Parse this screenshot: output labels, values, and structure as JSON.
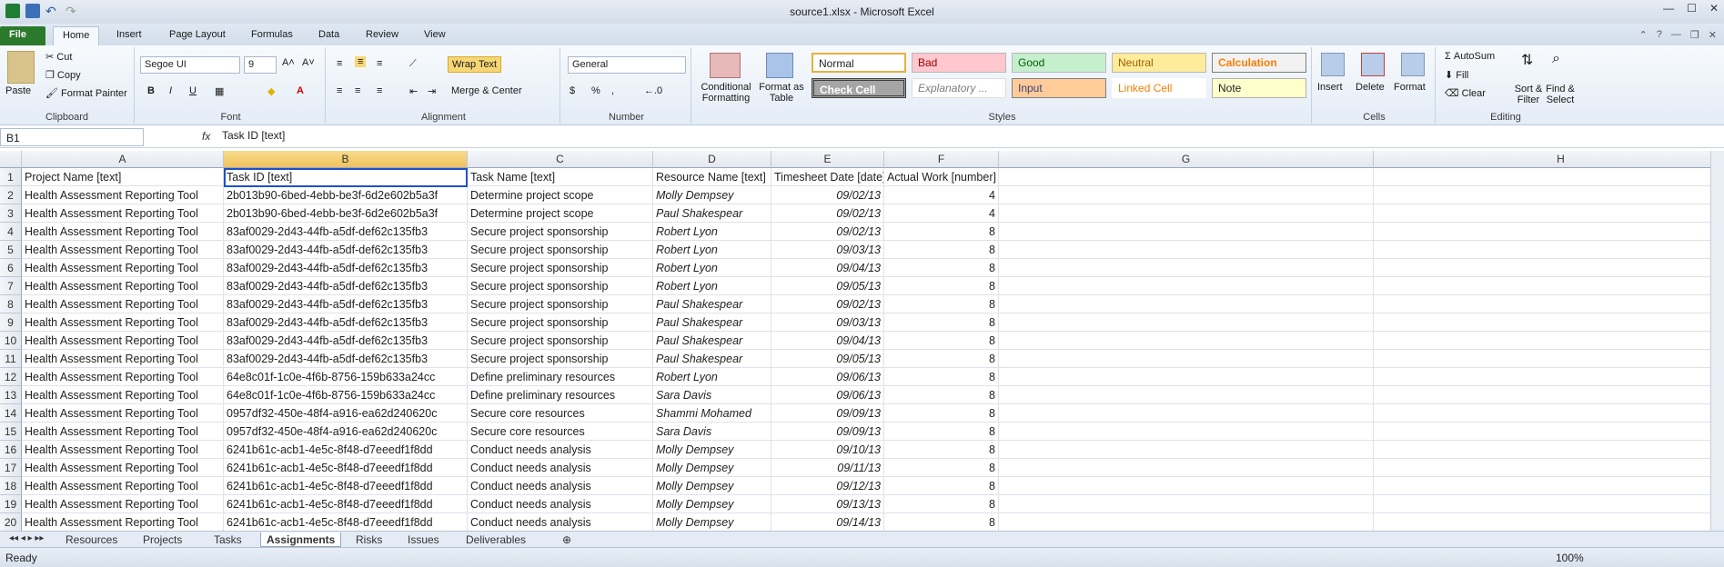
{
  "window": {
    "title": "source1.xlsx - Microsoft Excel"
  },
  "tabs": [
    "File",
    "Home",
    "Insert",
    "Page Layout",
    "Formulas",
    "Data",
    "Review",
    "View"
  ],
  "ribbon": {
    "clipboard": {
      "paste": "Paste",
      "cut": "Cut",
      "copy": "Copy",
      "format_painter": "Format Painter",
      "label": "Clipboard"
    },
    "font": {
      "name": "Segoe UI",
      "size": "9",
      "bold": "B",
      "italic": "I",
      "underline": "U",
      "label": "Font"
    },
    "alignment": {
      "wrap": "Wrap Text",
      "merge": "Merge & Center",
      "label": "Alignment"
    },
    "number": {
      "format": "General",
      "percent": "%",
      "comma": ",",
      "label": "Number"
    },
    "styles": {
      "conditional": "Conditional Formatting",
      "format_table": "Format as Table",
      "label": "Styles",
      "cells": [
        "Normal",
        "Bad",
        "Good",
        "Neutral",
        "Calculation",
        "Check Cell",
        "Explanatory ...",
        "Input",
        "Linked Cell",
        "Note"
      ]
    },
    "cells": {
      "insert": "Insert",
      "delete": "Delete",
      "format": "Format",
      "label": "Cells"
    },
    "editing": {
      "autosum": "AutoSum",
      "fill": "Fill",
      "clear": "Clear",
      "sort": "Sort & Filter",
      "find": "Find & Select",
      "label": "Editing"
    }
  },
  "formula_bar": {
    "name_box": "B1",
    "fx": "fx",
    "content": "Task ID [text]"
  },
  "columns": [
    "A",
    "B",
    "C",
    "D",
    "E",
    "F",
    "G",
    "H"
  ],
  "rows": [
    [
      "Project Name [text]",
      "Task ID [text]",
      "Task Name [text]",
      "Resource Name [text]",
      "Timesheet Date [date]",
      "Actual Work [number]"
    ],
    [
      "Health Assessment Reporting Tool",
      "2b013b90-6bed-4ebb-be3f-6d2e602b5a3f",
      "Determine project scope",
      "Molly Dempsey",
      "09/02/13",
      "4"
    ],
    [
      "Health Assessment Reporting Tool",
      "2b013b90-6bed-4ebb-be3f-6d2e602b5a3f",
      "Determine project scope",
      "Paul Shakespear",
      "09/02/13",
      "4"
    ],
    [
      "Health Assessment Reporting Tool",
      "83af0029-2d43-44fb-a5df-def62c135fb3",
      "Secure project sponsorship",
      "Robert Lyon",
      "09/02/13",
      "8"
    ],
    [
      "Health Assessment Reporting Tool",
      "83af0029-2d43-44fb-a5df-def62c135fb3",
      "Secure project sponsorship",
      "Robert Lyon",
      "09/03/13",
      "8"
    ],
    [
      "Health Assessment Reporting Tool",
      "83af0029-2d43-44fb-a5df-def62c135fb3",
      "Secure project sponsorship",
      "Robert Lyon",
      "09/04/13",
      "8"
    ],
    [
      "Health Assessment Reporting Tool",
      "83af0029-2d43-44fb-a5df-def62c135fb3",
      "Secure project sponsorship",
      "Robert Lyon",
      "09/05/13",
      "8"
    ],
    [
      "Health Assessment Reporting Tool",
      "83af0029-2d43-44fb-a5df-def62c135fb3",
      "Secure project sponsorship",
      "Paul Shakespear",
      "09/02/13",
      "8"
    ],
    [
      "Health Assessment Reporting Tool",
      "83af0029-2d43-44fb-a5df-def62c135fb3",
      "Secure project sponsorship",
      "Paul Shakespear",
      "09/03/13",
      "8"
    ],
    [
      "Health Assessment Reporting Tool",
      "83af0029-2d43-44fb-a5df-def62c135fb3",
      "Secure project sponsorship",
      "Paul Shakespear",
      "09/04/13",
      "8"
    ],
    [
      "Health Assessment Reporting Tool",
      "83af0029-2d43-44fb-a5df-def62c135fb3",
      "Secure project sponsorship",
      "Paul Shakespear",
      "09/05/13",
      "8"
    ],
    [
      "Health Assessment Reporting Tool",
      "64e8c01f-1c0e-4f6b-8756-159b633a24cc",
      "Define preliminary resources",
      "Robert Lyon",
      "09/06/13",
      "8"
    ],
    [
      "Health Assessment Reporting Tool",
      "64e8c01f-1c0e-4f6b-8756-159b633a24cc",
      "Define preliminary resources",
      "Sara Davis",
      "09/06/13",
      "8"
    ],
    [
      "Health Assessment Reporting Tool",
      "0957df32-450e-48f4-a916-ea62d240620c",
      "Secure core resources",
      "Shammi Mohamed",
      "09/09/13",
      "8"
    ],
    [
      "Health Assessment Reporting Tool",
      "0957df32-450e-48f4-a916-ea62d240620c",
      "Secure core resources",
      "Sara Davis",
      "09/09/13",
      "8"
    ],
    [
      "Health Assessment Reporting Tool",
      "6241b61c-acb1-4e5c-8f48-d7eeedf1f8dd",
      "Conduct needs analysis",
      "Molly Dempsey",
      "09/10/13",
      "8"
    ],
    [
      "Health Assessment Reporting Tool",
      "6241b61c-acb1-4e5c-8f48-d7eeedf1f8dd",
      "Conduct needs analysis",
      "Molly Dempsey",
      "09/11/13",
      "8"
    ],
    [
      "Health Assessment Reporting Tool",
      "6241b61c-acb1-4e5c-8f48-d7eeedf1f8dd",
      "Conduct needs analysis",
      "Molly Dempsey",
      "09/12/13",
      "8"
    ],
    [
      "Health Assessment Reporting Tool",
      "6241b61c-acb1-4e5c-8f48-d7eeedf1f8dd",
      "Conduct needs analysis",
      "Molly Dempsey",
      "09/13/13",
      "8"
    ],
    [
      "Health Assessment Reporting Tool",
      "6241b61c-acb1-4e5c-8f48-d7eeedf1f8dd",
      "Conduct needs analysis",
      "Molly Dempsey",
      "09/14/13",
      "8"
    ]
  ],
  "sheets": [
    "Resources",
    "Projects",
    "Tasks",
    "Assignments",
    "Risks",
    "Issues",
    "Deliverables"
  ],
  "active_sheet": "Assignments",
  "status": {
    "ready": "Ready",
    "zoom": "100%"
  }
}
